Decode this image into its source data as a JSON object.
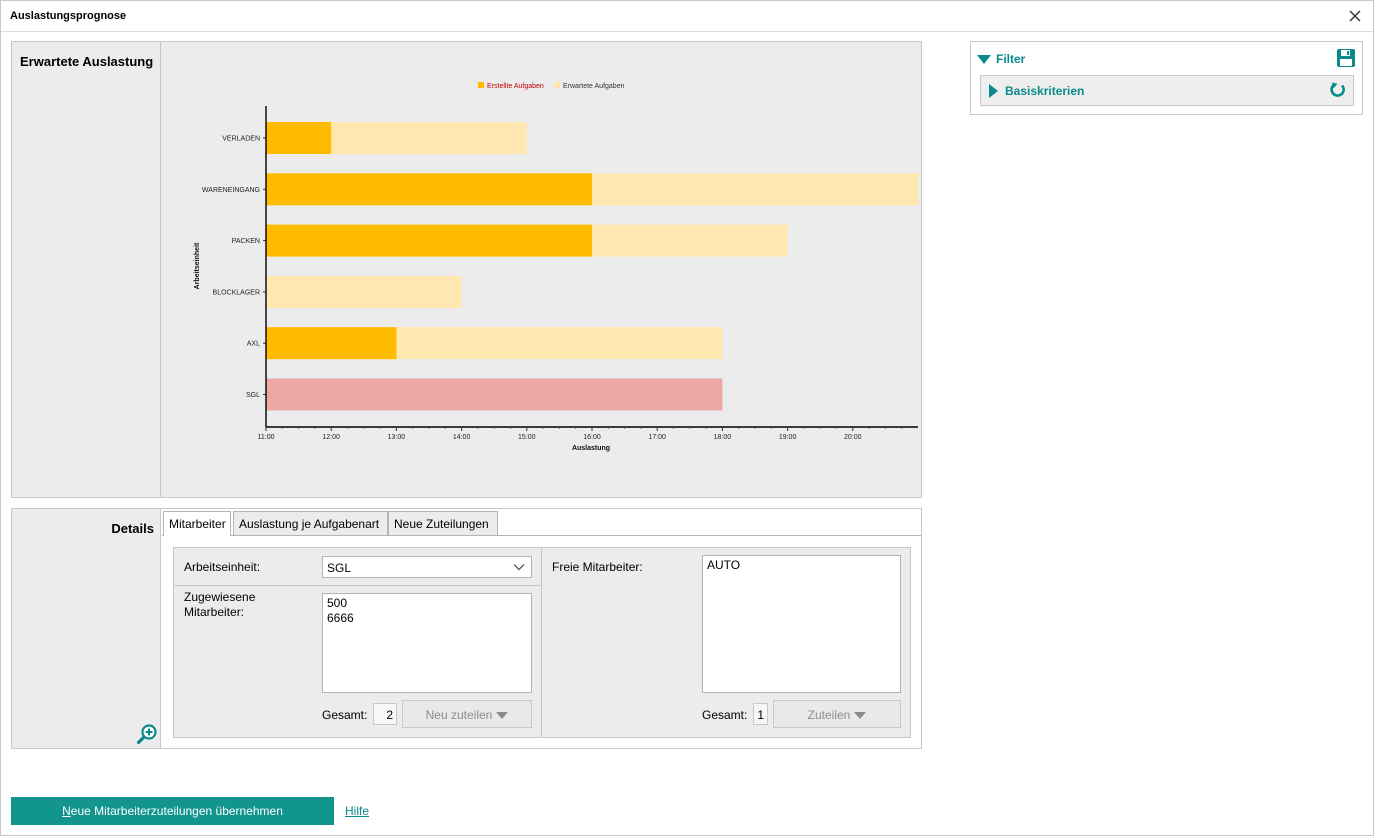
{
  "window": {
    "title": "Auslastungsprognose"
  },
  "chart_panel": {
    "label": "Erwartete Auslastung"
  },
  "chart_data": {
    "type": "bar",
    "orientation": "horizontal",
    "stacked": true,
    "categories": [
      "VERLADEN",
      "WARENEINGANG",
      "PACKEN",
      "BLOCKLAGER",
      "AXL",
      "SGL"
    ],
    "series": [
      {
        "name": "Erstellte Aufgaben",
        "color": "#ffbb00",
        "values_end": [
          "12:00",
          "16:00",
          "16:00",
          null,
          "13:00",
          null
        ]
      },
      {
        "name": "Erwartete Aufgaben",
        "color": "#ffe8b0",
        "values_end": [
          "15:00",
          "21:00",
          "19:00",
          "14:00",
          "18:00",
          null
        ]
      }
    ],
    "overloaded": {
      "category": "SGL",
      "color": "#eea7a7",
      "value_end": "18:00"
    },
    "x_start": "11:00",
    "x_ticks": [
      "11:00",
      "12:00",
      "13:00",
      "14:00",
      "15:00",
      "16:00",
      "17:00",
      "18:00",
      "19:00",
      "20:00"
    ],
    "xlabel": "Auslastung",
    "ylabel": "Arbeitseinheit",
    "legend_position": "top"
  },
  "filter": {
    "title": "Filter",
    "basis_label": "Basiskriterien"
  },
  "details": {
    "label": "Details",
    "tabs": [
      "Mitarbeiter",
      "Auslastung je Aufgabenart",
      "Neue Zuteilungen"
    ],
    "arbeitseinheit_label": "Arbeitseinheit:",
    "arbeitseinheit_value": "SGL",
    "zugewiesene_label_1": "Zugewiesene",
    "zugewiesene_label_2": "Mitarbeiter:",
    "zugewiesene_items": [
      "500",
      "6666"
    ],
    "gesamt_label_left": "Gesamt:",
    "gesamt_left": "2",
    "neu_zuteilen": "Neu zuteilen",
    "freie_label": "Freie Mitarbeiter:",
    "freie_items": [
      "AUTO"
    ],
    "gesamt_label_right": "Gesamt:",
    "gesamt_right": "1",
    "zuteilen": "Zuteilen"
  },
  "footer": {
    "primary_prefix": "N",
    "primary_rest": "eue Mitarbeiterzuteilungen übernehmen",
    "help": "Hilfe"
  }
}
